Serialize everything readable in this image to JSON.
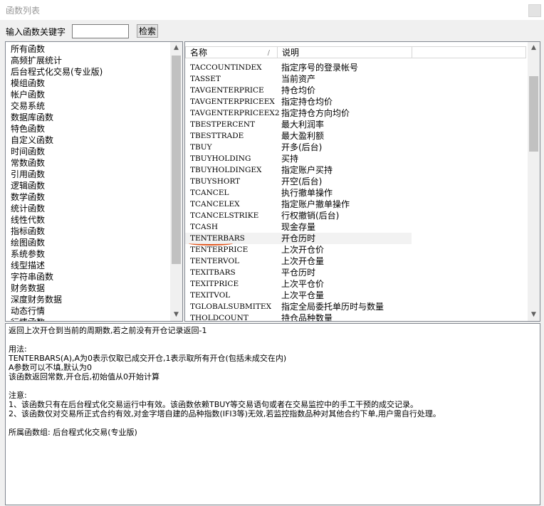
{
  "window": {
    "title": "函数列表"
  },
  "search": {
    "label": "输入函数关键字",
    "value": "",
    "button": "检索"
  },
  "categories": [
    "所有函数",
    "高频扩展统计",
    "后台程式化交易(专业版)",
    "模组函数",
    "帐户函数",
    "交易系统",
    "数据库函数",
    "特色函数",
    "自定义函数",
    "时间函数",
    "常数函数",
    "引用函数",
    "逻辑函数",
    "数学函数",
    "统计函数",
    "线性代数",
    "指标函数",
    "绘图函数",
    "系统参数",
    "线型描述",
    "字符串函数",
    "财务数据",
    "深度财务数据",
    "动态行情",
    "行情函数"
  ],
  "table": {
    "headers": {
      "name": "名称",
      "desc": "说明",
      "sort_glyph": "/"
    },
    "selected_index": 15,
    "rows": [
      {
        "name": "TACCOUNTINDEX",
        "desc": "指定序号的登录帐号"
      },
      {
        "name": "TASSET",
        "desc": "当前资产"
      },
      {
        "name": "TAVGENTERPRICE",
        "desc": "持仓均价"
      },
      {
        "name": "TAVGENTERPRICEEX",
        "desc": "指定持仓均价"
      },
      {
        "name": "TAVGENTERPRICEEX2",
        "desc": "指定持仓方向均价"
      },
      {
        "name": "TBESTPERCENT",
        "desc": "最大利润率"
      },
      {
        "name": "TBESTTRADE",
        "desc": "最大盈利额"
      },
      {
        "name": "TBUY",
        "desc": "开多(后台)"
      },
      {
        "name": "TBUYHOLDING",
        "desc": "买持"
      },
      {
        "name": "TBUYHOLDINGEX",
        "desc": "指定账户买持"
      },
      {
        "name": "TBUYSHORT",
        "desc": "开空(后台)"
      },
      {
        "name": "TCANCEL",
        "desc": "执行撤单操作"
      },
      {
        "name": "TCANCELEX",
        "desc": "指定账户撤单操作"
      },
      {
        "name": "TCANCELSTRIKE",
        "desc": "行权撤销(后台)"
      },
      {
        "name": "TCASH",
        "desc": "现金存量"
      },
      {
        "name": "TENTERBARS",
        "desc": "开仓历时"
      },
      {
        "name": "TENTERPRICE",
        "desc": "上次开仓价"
      },
      {
        "name": "TENTERVOL",
        "desc": "上次开仓量"
      },
      {
        "name": "TEXITBARS",
        "desc": "平仓历时"
      },
      {
        "name": "TEXITPRICE",
        "desc": "上次平仓价"
      },
      {
        "name": "TEXITVOL",
        "desc": "上次平仓量"
      },
      {
        "name": "TGLOBALSUBMITEX",
        "desc": "指定全局委托单历时与数量"
      },
      {
        "name": "THOLDCOUNT",
        "desc": "持仓品种数量"
      }
    ]
  },
  "detail": {
    "text": "返回上次开仓到当前的周期数,若之前没有开仓记录返回-1\n\n用法:\nTENTERBARS(A),A为0表示仅取已成交开仓,1表示取所有开仓(包括未成交在内)\nA参数可以不填,默认为0\n该函数返回常数,开仓后,初始值从0开始计算\n\n注意:\n1、该函数只有在后台程式化交易运行中有效。该函数依赖TBUY等交易语句或者在交易监控中的手工干预的成交记录。\n2、该函数仅对交易所正式合约有效,对金字塔自建的品种指数(IFI3等)无效,若监控指数品种对其他合约下单,用户需自行处理。\n\n所属函数组: 后台程式化交易(专业版)"
  },
  "colors": {
    "accent_underline": "#e2541b",
    "selection": "#f2f2f2"
  }
}
